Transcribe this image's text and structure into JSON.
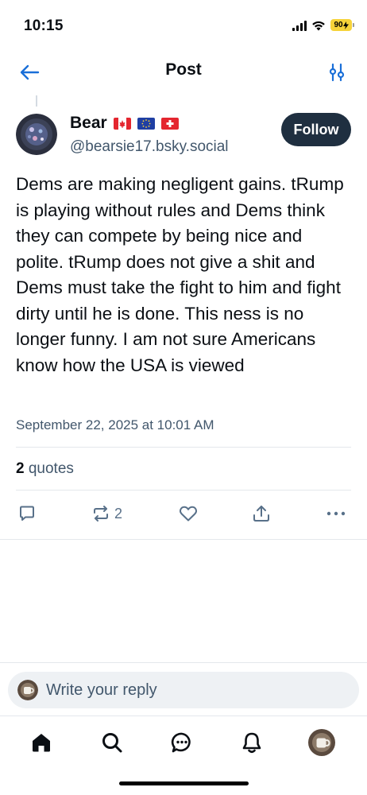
{
  "status_bar": {
    "time": "10:15",
    "battery": "90",
    "battery_color": "#f6d33a"
  },
  "header": {
    "title": "Post",
    "back_icon": "arrow-left-icon",
    "filter_icon": "sliders-icon"
  },
  "post": {
    "author": {
      "name": "Bear",
      "flags": [
        "flag-canada",
        "flag-eu",
        "flag-switzerland"
      ],
      "handle": "@bearsie17.bsky.social"
    },
    "follow_label": "Follow",
    "text": "Dems are making negligent gains. tRump is playing without rules and Dems think they can compete by being nice and polite. tRump does not give a shit and Dems must take the fight to him and fight dirty until he is done. This ness is no longer funny. I am not sure Americans know how the USA is viewed",
    "date": "September 22, 2025 at 10:01 AM",
    "quotes": {
      "count": "2",
      "label": "quotes"
    },
    "actions": {
      "reply_icon": "reply-icon",
      "repost_icon": "repost-icon",
      "repost_count": "2",
      "like_icon": "heart-icon",
      "share_icon": "share-icon",
      "more_icon": "more-dots-icon"
    }
  },
  "reply": {
    "placeholder": "Write your reply"
  },
  "bottom_nav": {
    "items": [
      "home-icon",
      "search-icon",
      "chat-icon",
      "bell-icon",
      "profile-avatar"
    ]
  },
  "colors": {
    "accent": "#1f2f40",
    "secondary_text": "#42576c",
    "icon": "#587089"
  }
}
